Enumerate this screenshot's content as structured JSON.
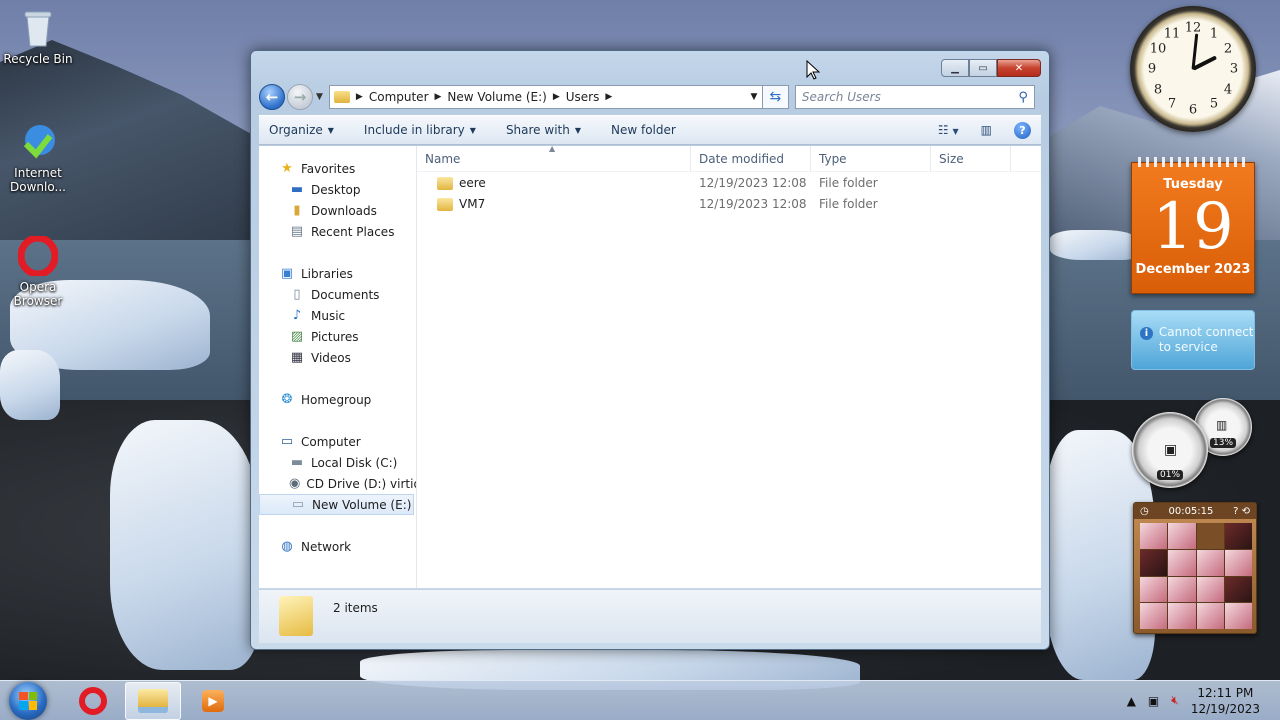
{
  "desktop": {
    "icons": [
      {
        "label": "Recycle Bin",
        "glyph": "recycle-bin-icon"
      },
      {
        "label": "Internet Downlo...",
        "glyph": "internet-download-manager-icon"
      },
      {
        "label": "Opera Browser",
        "glyph": "opera-icon"
      }
    ]
  },
  "window": {
    "address": {
      "segments": [
        "Computer",
        "New Volume (E:)",
        "Users"
      ]
    },
    "search": {
      "placeholder": "Search Users"
    },
    "toolbar": {
      "organize": "Organize",
      "include_in_library": "Include in library",
      "share_with": "Share with",
      "new_folder": "New folder"
    },
    "nav": {
      "favorites": {
        "label": "Favorites",
        "items": [
          "Desktop",
          "Downloads",
          "Recent Places"
        ]
      },
      "libraries": {
        "label": "Libraries",
        "items": [
          "Documents",
          "Music",
          "Pictures",
          "Videos"
        ]
      },
      "homegroup": "Homegroup",
      "computer": {
        "label": "Computer",
        "items": [
          "Local Disk (C:)",
          "CD Drive (D:) virtio-w",
          "New Volume (E:)"
        ]
      },
      "network": "Network"
    },
    "columns": {
      "name": "Name",
      "date_modified": "Date modified",
      "type": "Type",
      "size": "Size"
    },
    "files": [
      {
        "name": "eere",
        "date": "12/19/2023 12:08 ...",
        "type": "File folder"
      },
      {
        "name": "VM7",
        "date": "12/19/2023 12:08 ...",
        "type": "File folder"
      }
    ],
    "status": "2 items"
  },
  "gadgets": {
    "clock": {
      "numbers": [
        "12",
        "1",
        "2",
        "3",
        "4",
        "5",
        "6",
        "7",
        "8",
        "9",
        "10",
        "11"
      ]
    },
    "calendar": {
      "day": "Tuesday",
      "date": "19",
      "month": "December 2023"
    },
    "weather": {
      "message": "Cannot connect to service"
    },
    "meter": {
      "cpu": "01%",
      "memory": "13%"
    },
    "puzzle": {
      "timer": "00:05:15"
    }
  },
  "taskbar": {
    "time": "12:11 PM",
    "date": "12/19/2023"
  },
  "colors": {
    "accent": "#2d6fc9",
    "calendar": "#e8690f",
    "opera": "#e21b25"
  }
}
